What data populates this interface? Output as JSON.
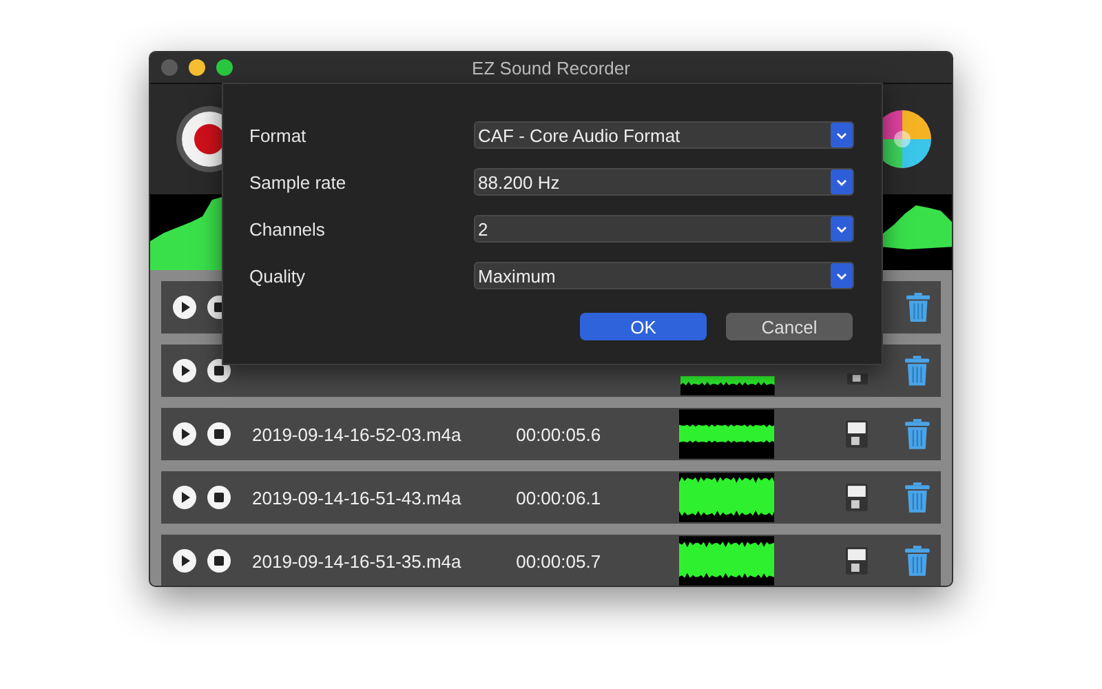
{
  "window": {
    "title": "EZ Sound Recorder"
  },
  "settings": [
    {
      "label": "Format",
      "value": "CAF - Core Audio Format"
    },
    {
      "label": "Sample rate",
      "value": "88.200 Hz"
    },
    {
      "label": "Channels",
      "value": "2"
    },
    {
      "label": "Quality",
      "value": "Maximum"
    }
  ],
  "buttons": [
    {
      "label": "OK",
      "kind": "primary"
    },
    {
      "label": "Cancel",
      "kind": "secondary"
    }
  ],
  "files": [
    {
      "kind": "covered"
    },
    {
      "kind": "partial"
    },
    {
      "kind": "shown",
      "name": "2019-09-14-16-52-03.m4a",
      "duration": "00:00:05.6"
    },
    {
      "kind": "shown",
      "name": "2019-09-14-16-51-43.m4a",
      "duration": "00:00:06.1"
    },
    {
      "kind": "shown",
      "name": "2019-09-14-16-51-35.m4a",
      "duration": "00:00:05.7"
    }
  ]
}
